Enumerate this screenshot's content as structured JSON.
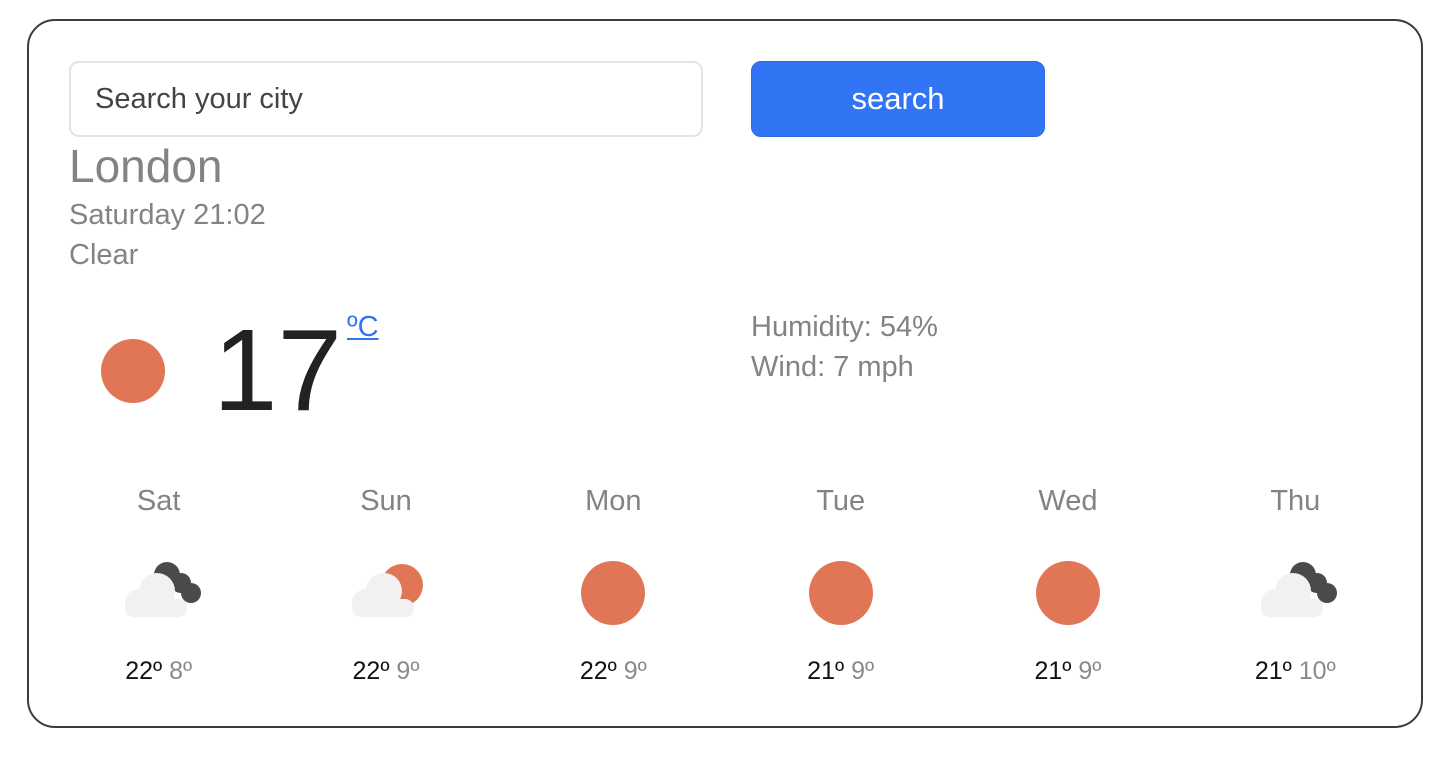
{
  "search": {
    "placeholder": "Search your city",
    "value": "",
    "button_label": "search"
  },
  "current": {
    "city": "London",
    "datetime": "Saturday 21:02",
    "condition": "Clear",
    "icon": "sun-icon",
    "temperature": "17",
    "unit": "ºC",
    "humidity": "Humidity: 54%",
    "wind": "Wind: 7 mph"
  },
  "forecast": [
    {
      "day": "Sat",
      "icon": "cloud-night-icon",
      "high": "22º",
      "low": "8º"
    },
    {
      "day": "Sun",
      "icon": "cloud-sun-icon",
      "high": "22º",
      "low": "9º"
    },
    {
      "day": "Mon",
      "icon": "sun-icon",
      "high": "22º",
      "low": "9º"
    },
    {
      "day": "Tue",
      "icon": "sun-icon",
      "high": "21º",
      "low": "9º"
    },
    {
      "day": "Wed",
      "icon": "sun-icon",
      "high": "21º",
      "low": "9º"
    },
    {
      "day": "Thu",
      "icon": "cloud-night-icon",
      "high": "21º",
      "low": "10º"
    }
  ],
  "colors": {
    "accent": "#3174f4",
    "sun": "#e07656",
    "cloud": "#f1f1f0",
    "dark_cloud": "#4a4a4c",
    "muted_text": "#838383"
  }
}
